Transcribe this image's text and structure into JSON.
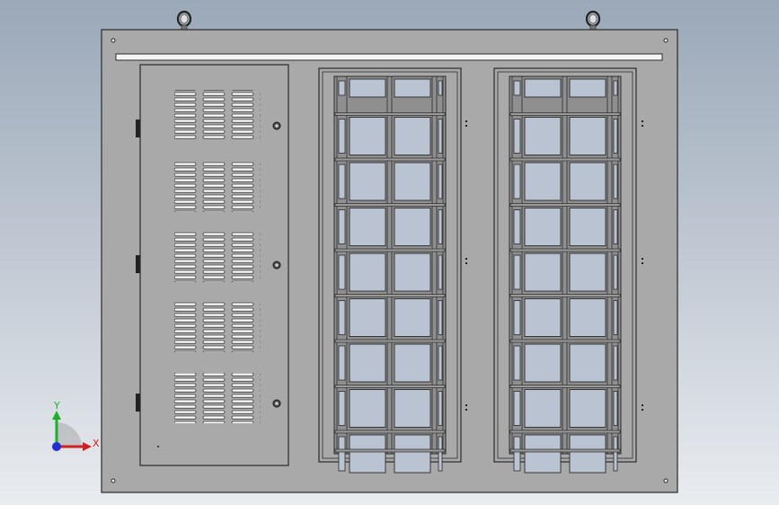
{
  "scene": {
    "background_top": "#9aa8b8",
    "background_bottom": "#e9ecef",
    "panel_color": "#a9a9a9",
    "louver_color": "#ffffff",
    "glass_color": "#b9c3d1",
    "frame_color": "#8f8f8f"
  },
  "triad": {
    "x_label": "X",
    "y_label": "Y",
    "x_color": "#d21f1f",
    "y_color": "#1fae2a",
    "z_color": "#1f2fd2",
    "icon": "coordinate-triad-icon"
  }
}
